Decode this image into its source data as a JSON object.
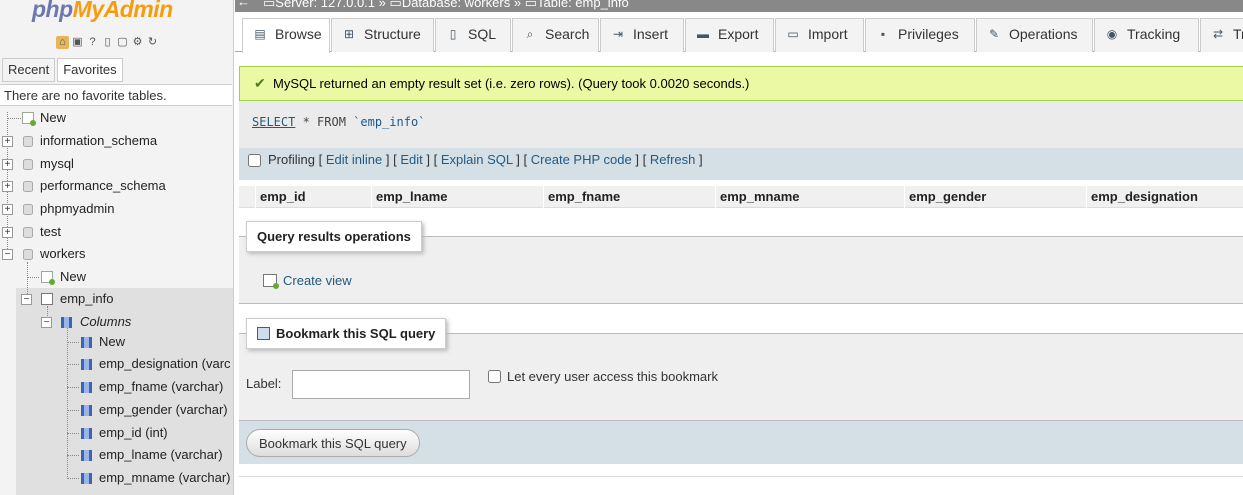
{
  "logo": {
    "part1": "php",
    "part2": "MyAdmin"
  },
  "nav_tabs": {
    "recent": "Recent",
    "favorites": "Favorites"
  },
  "favorites_message": "There are no favorite tables.",
  "tree": {
    "new": "New",
    "databases": [
      "information_schema",
      "mysql",
      "performance_schema",
      "phpmyadmin",
      "test",
      "workers"
    ],
    "workers_new": "New",
    "table": "emp_info",
    "columns_label": "Columns",
    "columns_new": "New",
    "columns": [
      "emp_designation (varc",
      "emp_fname (varchar)",
      "emp_gender (varchar)",
      "emp_id (int)",
      "emp_lname (varchar)",
      "emp_mname (varchar)"
    ]
  },
  "breadcrumb": {
    "server": "Server: 127.0.0.1",
    "database": "Database: workers",
    "table": "Table: emp_info",
    "sep": "»"
  },
  "tabs": [
    {
      "label": "Browse",
      "icon": "browse-icon"
    },
    {
      "label": "Structure",
      "icon": "structure-icon"
    },
    {
      "label": "SQL",
      "icon": "sql-icon"
    },
    {
      "label": "Search",
      "icon": "search-icon"
    },
    {
      "label": "Insert",
      "icon": "insert-icon"
    },
    {
      "label": "Export",
      "icon": "export-icon"
    },
    {
      "label": "Import",
      "icon": "import-icon"
    },
    {
      "label": "Privileges",
      "icon": "privileges-icon"
    },
    {
      "label": "Operations",
      "icon": "operations-icon"
    },
    {
      "label": "Tracking",
      "icon": "tracking-icon"
    },
    {
      "label": "Tr",
      "icon": "triggers-icon"
    }
  ],
  "success_message": "MySQL returned an empty result set (i.e. zero rows). (Query took 0.0020 seconds.)",
  "sql": {
    "select": "SELECT",
    "rest": " * FROM ",
    "table": "`emp_info`"
  },
  "profiling": {
    "label": "Profiling",
    "edit_inline": "Edit inline",
    "edit": "Edit",
    "explain": "Explain SQL",
    "create_php": "Create PHP code",
    "refresh": "Refresh",
    "open": "[",
    "close": "]"
  },
  "columns_header": [
    "emp_id",
    "emp_lname",
    "emp_fname",
    "emp_mname",
    "emp_gender",
    "emp_designation"
  ],
  "query_results_ops": {
    "legend": "Query results operations",
    "create_view": "Create view"
  },
  "bookmark": {
    "legend": "Bookmark this SQL query",
    "label": "Label:",
    "label_value": "",
    "every_user": "Let every user access this bookmark",
    "button": "Bookmark this SQL query"
  },
  "colors": {
    "success_bg": "#ebf8a4",
    "link": "#235a81",
    "panel_blue": "#d5dfe6"
  }
}
